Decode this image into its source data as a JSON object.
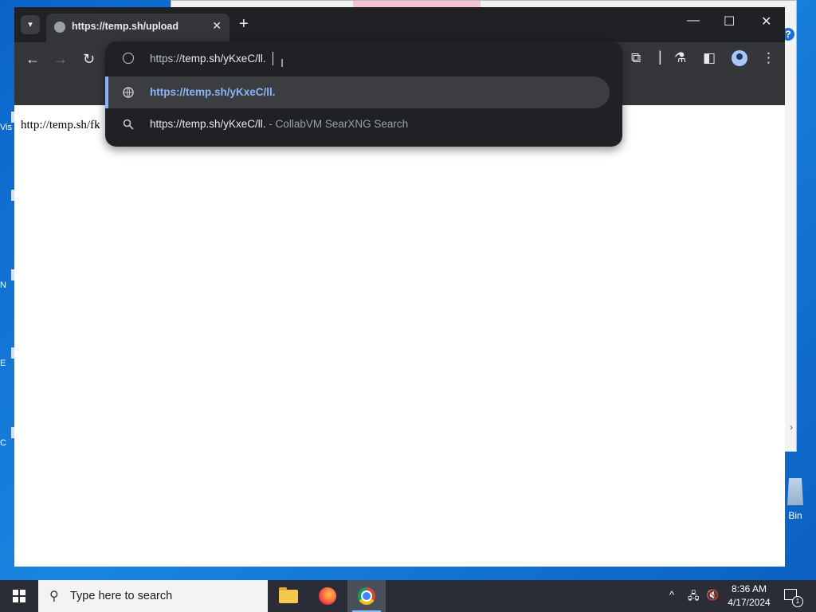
{
  "desktop": {
    "icon_labels": [
      "Vis",
      "N",
      "E",
      "C"
    ],
    "recycle_bin_label": "Bin",
    "background_help_icon": "?"
  },
  "browser": {
    "tab": {
      "title": "https://temp.sh/upload"
    },
    "window_controls": {
      "minimize": "—",
      "maximize": "☐",
      "close": "✕"
    },
    "omnibox": {
      "typed_prefix": "https://",
      "typed_main": "temp.sh/yKxeC/ll.",
      "suggestions": [
        {
          "icon": "globe-icon",
          "text": "https://temp.sh/yKxeC/ll.",
          "sub": "",
          "selected": true
        },
        {
          "icon": "search-icon",
          "text": "https://temp.sh/yKxeC/ll.",
          "sub": " - CollabVM SearXNG Search",
          "selected": false
        }
      ]
    },
    "page": {
      "body_text": "http://temp.sh/fk"
    }
  },
  "taskbar": {
    "search_placeholder": "Type here to search",
    "apps": [
      "file-explorer",
      "firefox",
      "chrome"
    ],
    "active_app": "chrome",
    "clock": {
      "time": "8:36 AM",
      "date": "4/17/2024"
    },
    "notification_count": "1"
  },
  "colors": {
    "chrome_dark": "#202124",
    "toolbar": "#35363a",
    "link_blue": "#8ab4f8",
    "desktop_blue": "#0a63c9",
    "taskbar": "#2a2d36"
  }
}
